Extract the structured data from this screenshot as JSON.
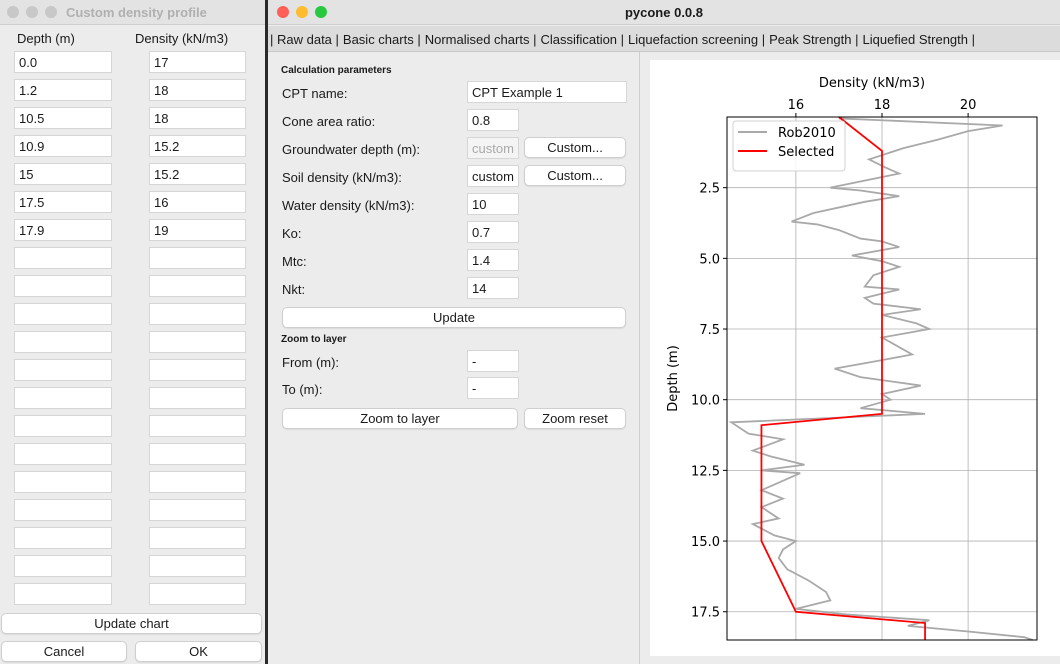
{
  "density_window": {
    "title": "Custom density profile",
    "col_depth": "Depth (m)",
    "col_density": "Density (kN/m3)",
    "rows": [
      [
        "0.0",
        "17"
      ],
      [
        "1.2",
        "18"
      ],
      [
        "10.5",
        "18"
      ],
      [
        "10.9",
        "15.2"
      ],
      [
        "15",
        "15.2"
      ],
      [
        "17.5",
        "16"
      ],
      [
        "17.9",
        "19"
      ],
      [
        "",
        ""
      ],
      [
        "",
        ""
      ],
      [
        "",
        ""
      ],
      [
        "",
        ""
      ],
      [
        "",
        ""
      ],
      [
        "",
        ""
      ],
      [
        "",
        ""
      ],
      [
        "",
        ""
      ],
      [
        "",
        ""
      ],
      [
        "",
        ""
      ],
      [
        "",
        ""
      ],
      [
        "",
        ""
      ],
      [
        "",
        ""
      ]
    ],
    "update_chart": "Update chart",
    "cancel": "Cancel",
    "ok": "OK"
  },
  "main_window": {
    "title": "pycone 0.0.8",
    "tabs": [
      "| Raw data |",
      "Basic charts |",
      "Normalised charts |",
      "Classification |",
      "Liquefaction screening |",
      "Peak Strength |",
      "Liquefied Strength |"
    ],
    "calc_heading": "Calculation parameters",
    "fields": [
      {
        "label": "CPT name:",
        "value": "CPT Example 1"
      },
      {
        "label": "Cone area ratio:",
        "value": "0.8"
      },
      {
        "label": "Groundwater depth (m):",
        "value": "custom",
        "button": "Custom..."
      },
      {
        "label": "Soil density (kN/m3):",
        "value": "custom",
        "button": "Custom..."
      },
      {
        "label": "Water density (kN/m3):",
        "value": "10"
      },
      {
        "label": "Ko:",
        "value": "0.7"
      },
      {
        "label": "Mtc:",
        "value": "1.4"
      },
      {
        "label": "Nkt:",
        "value": "14"
      }
    ],
    "update": "Update",
    "zoom_heading": "Zoom to layer",
    "from_label": "From (m):",
    "from_value": "-",
    "to_label": "To (m):",
    "to_value": "-",
    "zoom_button": "Zoom to layer",
    "zoom_reset": "Zoom reset"
  },
  "colors": {
    "selected": "#ff0000",
    "rob2010": "#a9a9a9",
    "close": "#fe5f57",
    "min": "#febc2e",
    "max": "#28c840"
  },
  "chart_data": {
    "type": "line",
    "xlabel": "Density (kN/m3)",
    "ylabel": "Depth (m)",
    "xlim": [
      14.4,
      21.6
    ],
    "ylim": [
      18.5,
      0
    ],
    "y_inverted": true,
    "x_axis_position": "top",
    "xticks": [
      "16",
      "18",
      "20"
    ],
    "yticks": [
      "2.5",
      "5.0",
      "7.5",
      "10.0",
      "12.5",
      "15.0",
      "17.5"
    ],
    "grid": true,
    "legend": "top-left",
    "series": [
      {
        "name": "Rob2010",
        "color": "#a9a9a9",
        "points": [
          [
            17,
            0.05
          ],
          [
            20.8,
            0.3
          ],
          [
            20,
            0.5
          ],
          [
            19.3,
            0.8
          ],
          [
            18.5,
            1.1
          ],
          [
            17.7,
            1.5
          ],
          [
            18.1,
            1.8
          ],
          [
            18.4,
            2.0
          ],
          [
            16.8,
            2.5
          ],
          [
            17.5,
            2.6
          ],
          [
            18.4,
            2.8
          ],
          [
            17.6,
            3.0
          ],
          [
            16.4,
            3.4
          ],
          [
            15.9,
            3.7
          ],
          [
            16.5,
            3.8
          ],
          [
            17,
            4.0
          ],
          [
            17.5,
            4.3
          ],
          [
            18,
            4.4
          ],
          [
            18.4,
            4.6
          ],
          [
            17.3,
            4.9
          ],
          [
            18,
            5.1
          ],
          [
            18.4,
            5.3
          ],
          [
            17.8,
            5.6
          ],
          [
            17.6,
            6.0
          ],
          [
            18.4,
            6.1
          ],
          [
            17.6,
            6.4
          ],
          [
            17.8,
            6.6
          ],
          [
            18.9,
            6.8
          ],
          [
            18,
            7.0
          ],
          [
            18.8,
            7.3
          ],
          [
            19.1,
            7.5
          ],
          [
            18,
            7.8
          ],
          [
            18.7,
            8.4
          ],
          [
            18,
            8.6
          ],
          [
            16.9,
            8.9
          ],
          [
            17.5,
            9.2
          ],
          [
            18.9,
            9.5
          ],
          [
            18,
            9.8
          ],
          [
            18.2,
            10.0
          ],
          [
            17.5,
            10.3
          ],
          [
            19,
            10.5
          ],
          [
            14.5,
            10.8
          ],
          [
            14.9,
            11.2
          ],
          [
            15.7,
            11.4
          ],
          [
            15,
            11.8
          ],
          [
            15.4,
            12
          ],
          [
            16.2,
            12.3
          ],
          [
            15.2,
            12.5
          ],
          [
            16.1,
            12.6
          ],
          [
            15.5,
            13
          ],
          [
            15.2,
            13.2
          ],
          [
            15.7,
            13.5
          ],
          [
            15.2,
            13.8
          ],
          [
            15.6,
            14.2
          ],
          [
            15,
            14.4
          ],
          [
            15.5,
            14.8
          ],
          [
            16,
            15
          ],
          [
            15.7,
            15.3
          ],
          [
            15.6,
            15.6
          ],
          [
            15.8,
            16
          ],
          [
            16.3,
            16.4
          ],
          [
            16.7,
            16.8
          ],
          [
            16.8,
            17.1
          ],
          [
            16,
            17.4
          ],
          [
            17.2,
            17.6
          ],
          [
            19.1,
            17.8
          ],
          [
            18.6,
            18
          ],
          [
            20,
            18.2
          ],
          [
            21.3,
            18.4
          ],
          [
            21.5,
            18.5
          ]
        ]
      },
      {
        "name": "Selected",
        "color": "#ff0000",
        "points": [
          [
            17,
            0
          ],
          [
            18,
            1.2
          ],
          [
            18,
            10.5
          ],
          [
            15.2,
            10.9
          ],
          [
            15.2,
            15
          ],
          [
            16,
            17.5
          ],
          [
            19,
            17.9
          ],
          [
            19,
            18.5
          ]
        ]
      }
    ]
  }
}
